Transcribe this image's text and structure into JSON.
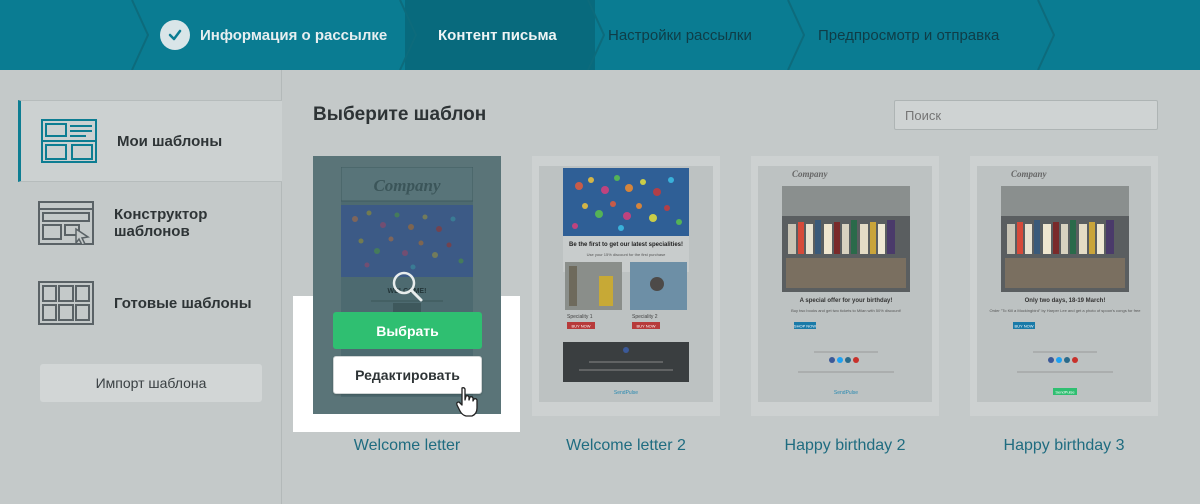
{
  "stepper": {
    "steps": [
      {
        "label": "Информация о рассылке",
        "state": "done"
      },
      {
        "label": "Контент письма",
        "state": "active"
      },
      {
        "label": "Настройки рассылки",
        "state": "pending"
      },
      {
        "label": "Предпросмотр и отправка",
        "state": "pending"
      }
    ]
  },
  "sidebar": {
    "items": [
      {
        "label": "Мои шаблоны",
        "icon": "layout-template-icon"
      },
      {
        "label": "Конструктор шаблонов",
        "icon": "template-builder-icon"
      },
      {
        "label": "Готовые шаблоны",
        "icon": "grid-templates-icon"
      }
    ],
    "import_label": "Импорт шаблона"
  },
  "main": {
    "title": "Выберите шаблон",
    "search_placeholder": "Поиск",
    "cards": [
      {
        "name": "Welcome letter"
      },
      {
        "name": "Welcome letter 2"
      },
      {
        "name": "Happy birthday 2"
      },
      {
        "name": "Happy birthday 3"
      }
    ],
    "hover": {
      "select_label": "Выбрать",
      "edit_label": "Редактировать"
    }
  },
  "thumbs": {
    "company": "Company",
    "welcome_heading": "WELCOME!",
    "specialities_heading": "Be the first to get our latest specialities!",
    "discount": "Use your 15% discount for the first purchase",
    "speciality1": "Speciality 1",
    "speciality2": "Speciality 2",
    "buy_now": "BUY NOW",
    "shop_now": "SHOP NOW",
    "offer_heading": "A special offer for your birthday!",
    "offer_text": "Buy two books and get two tickets to Milan with 50% discount!",
    "countdown_heading": "Only two days, 18-19 March!",
    "countdown_text": "Order \"To Kill a Mockingbird\" by Harper Lee and get a photo of spoon's congs for free",
    "sendpulse": "SendPulse"
  },
  "colors": {
    "accent": "#0a7c92",
    "select": "#2fbf71",
    "link": "#1f6c80"
  }
}
